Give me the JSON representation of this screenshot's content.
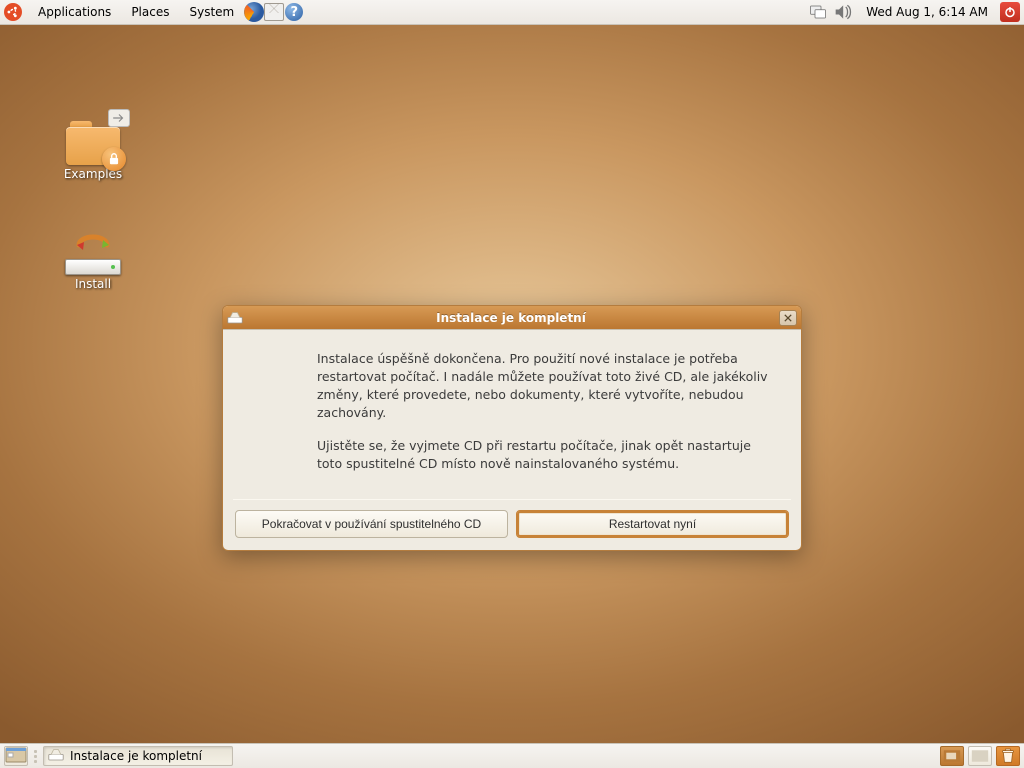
{
  "panel": {
    "menus": {
      "applications": "Applications",
      "places": "Places",
      "system": "System"
    },
    "clock": "Wed Aug  1,  6:14 AM"
  },
  "desktop": {
    "examples_label": "Examples",
    "install_label": "Install"
  },
  "dialog": {
    "title": "Instalace je kompletní",
    "paragraph1": "Instalace úspěšně dokončena. Pro použití nové instalace je potřeba restartovat počítač. I nadále můžete používat toto živé CD, ale jakékoliv změny, které provedete, nebo dokumenty, které vytvoříte, nebudou zachovány.",
    "paragraph2": "Ujistěte se, že vyjmete CD při restartu počítače, jinak opět nastartuje toto spustitelné CD místo nově nainstalovaného systému.",
    "continue_label": "Pokračovat v používání spustitelného CD",
    "restart_label": "Restartovat nyní"
  },
  "taskbar": {
    "task_title": "Instalace je kompletní"
  }
}
